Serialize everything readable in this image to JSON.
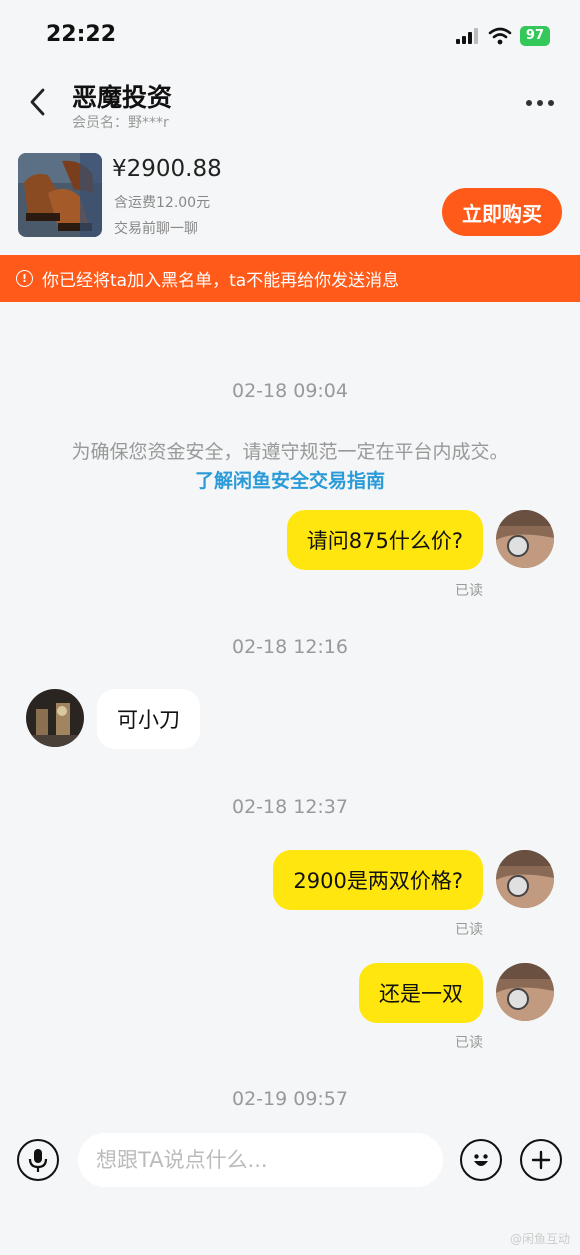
{
  "status_bar": {
    "time": "22:22",
    "battery": "97"
  },
  "header": {
    "title": "恶魔投资",
    "subtitle": "会员名：野***r",
    "back_icon": "chevron-left-icon",
    "more_icon": "more-dots-icon"
  },
  "product": {
    "price": "¥2900.88",
    "shipping": "含运费12.00元",
    "chat_hint": "交易前聊一聊",
    "buy_label": "立即购买"
  },
  "banner": {
    "icon": "!",
    "text": "你已经将ta加入黑名单，ta不能再给你发送消息"
  },
  "chat": {
    "notice": "为确保您资金安全，请遵守规范一定在平台内成交。",
    "notice_link": "了解闲鱼安全交易指南",
    "timestamps": [
      "02-18 09:04",
      "02-18 12:16",
      "02-18 12:37",
      "02-19 09:57"
    ],
    "messages": [
      {
        "direction": "out",
        "text": "请问875什么价?",
        "status": "已读"
      },
      {
        "direction": "in",
        "text": "可小刀"
      },
      {
        "direction": "out",
        "text": "2900是两双价格?",
        "status": "已读"
      },
      {
        "direction": "out",
        "text": "还是一双",
        "status": "已读"
      }
    ]
  },
  "input_bar": {
    "placeholder": "想跟TA说点什么...",
    "voice_icon": "microphone-icon",
    "emoji_icon": "smiley-icon",
    "plus_icon": "plus-icon"
  },
  "watermark": "@闲鱼互动",
  "colors": {
    "accent": "#ff5a19",
    "bubble_out": "#ffe60f",
    "link": "#2a9bd8"
  }
}
